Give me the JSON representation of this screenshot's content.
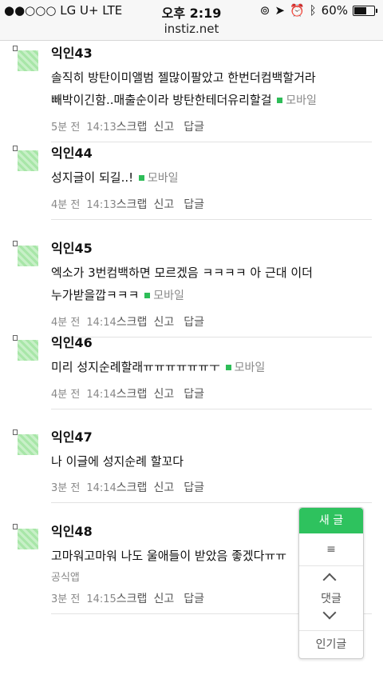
{
  "status": {
    "carrier": "●●○○○ LG U+  LTE",
    "time": "오후 2:19",
    "battery": "60%"
  },
  "url": "instiz.net",
  "comments": [
    {
      "nick": "익인43",
      "text": "솔직히 방탄이미앨범 젤많이팔았고 한번더컴백할거라 빼박이긴함..매출순이라 방탄한테더유리할걸",
      "tag": "모바일",
      "age": "5분 전",
      "time": "14:13"
    },
    {
      "nick": "익인44",
      "text": "성지글이 되길..!",
      "tag": "모바일",
      "age": "4분 전",
      "time": "14:13"
    },
    {
      "nick": "익인45",
      "text": "엑소가 3번컴백하면 모르겠음 ㅋㅋㅋㅋ 아 근대 이더 누가받을깝ㅋㅋㅋ",
      "tag": "모바일",
      "age": "4분 전",
      "time": "14:14"
    },
    {
      "nick": "익인46",
      "text": "미리 성지순례할래ㅠㅠㅠㅠㅠㅠㅜ",
      "tag": "모바일",
      "age": "4분 전",
      "time": "14:14"
    },
    {
      "nick": "익인47",
      "text": "나 이글에 성지순례 할꼬다",
      "tag": "",
      "age": "3분 전",
      "time": "14:14"
    },
    {
      "nick": "익인48",
      "text": "고마워고마워 나도 울애들이 받았음 좋겠다ㅠㅠ",
      "tag": "",
      "app": "공식앱",
      "age": "3분 전",
      "time": "14:15"
    }
  ],
  "actions": {
    "scrap": "스크랩",
    "report": "신고",
    "reply": "답글"
  },
  "floatnav": {
    "new": "새 글",
    "menu": "≡",
    "comments": "댓글",
    "popular": "인기글"
  }
}
